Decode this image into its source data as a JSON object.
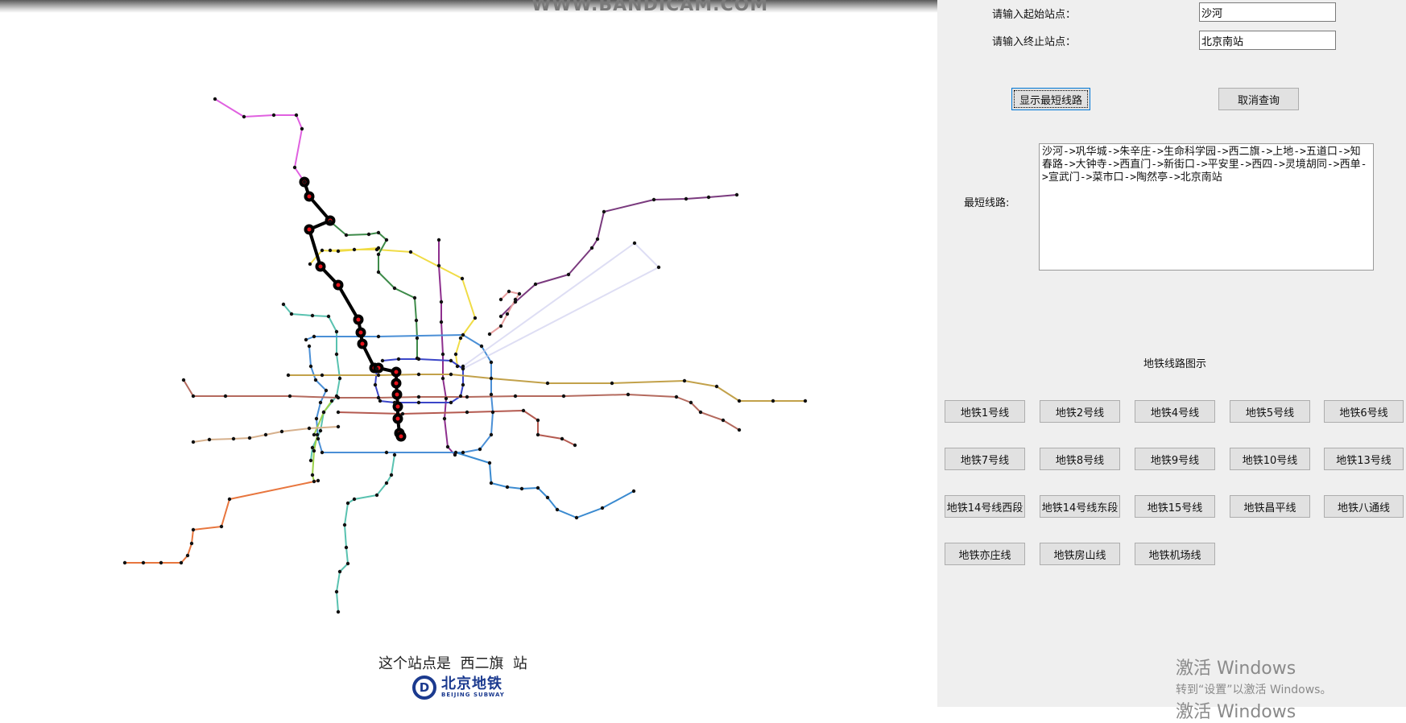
{
  "watermark_top": "WWW.BANDICAM.COM",
  "form": {
    "start_label": "请输入起始站点：",
    "start_value": "沙河",
    "end_label": "请输入终止站点：",
    "end_value": "北京南站",
    "show_button": "显示最短线路",
    "cancel_button": "取消查询",
    "result_label": "最短线路:",
    "result_text": "沙河->巩华城->朱辛庄->生命科学园->西二旗->上地->五道口->知春路->大钟寺->西直门->新街口->平安里->西四->灵境胡同->西单->宣武门->菜市口->陶然亭->北京南站"
  },
  "legend": {
    "title": "地铁线路图示",
    "buttons": [
      "地铁1号线",
      "地铁2号线",
      "地铁4号线",
      "地铁5号线",
      "地铁6号线",
      "地铁7号线",
      "地铁8号线",
      "地铁9号线",
      "地铁10号线",
      "地铁13号线",
      "地铁14号线西段",
      "地铁14号线东段",
      "地铁15号线",
      "地铁昌平线",
      "地铁八通线",
      "地铁亦庄线",
      "地铁房山线",
      "地铁机场线"
    ]
  },
  "station_caption": "这个站点是  西二旗  站",
  "logo": {
    "cn": "北京地铁",
    "en": "BEIJING SUBWAY"
  },
  "os_notice": {
    "line1": "激活 Windows",
    "line2": "转到“设置”以激活 Windows。",
    "line3": "激活 Windows"
  },
  "colors": {
    "line1": "#b46a5e",
    "line2": "#4a8fd6",
    "line4": "#59c2b0",
    "line5": "#8e2f8e",
    "line6": "#c2a14a",
    "line7": "#e8b48a",
    "line8": "#3e8b4a",
    "line9": "#9bd14a",
    "line10": "#3a8ad0",
    "line13": "#f0dc46",
    "line14w": "#d6b08c",
    "line14e": "#e8a0a0",
    "line15": "#7a3a7e",
    "changping": "#e060e0",
    "batong": "#b45a50",
    "yizhuang": "#d870b0",
    "fangshan": "#e8763e",
    "airport": "#d0d0f0",
    "loop2": "#3b46c8",
    "highlight": "#e8141c"
  }
}
